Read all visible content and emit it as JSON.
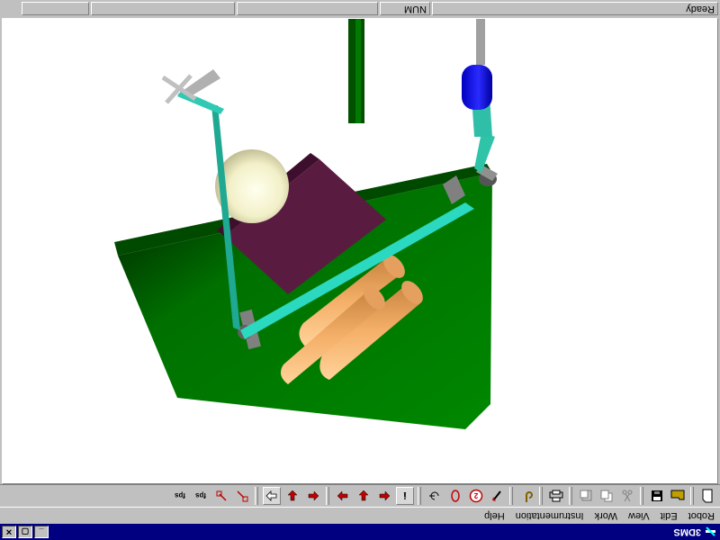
{
  "window": {
    "title": "3DMS"
  },
  "menu": [
    "Robot",
    "Edit",
    "View",
    "Work",
    "Instrumentation",
    "Help"
  ],
  "toolbar": {
    "buttons": [
      {
        "icon": "new-document-icon"
      },
      {
        "icon": "open-folder-icon"
      },
      {
        "icon": "save-disk-icon"
      },
      {
        "icon": "cut-icon"
      },
      {
        "icon": "copy-icon"
      },
      {
        "icon": "paste-icon"
      },
      {
        "icon": "print-icon"
      },
      {
        "icon": "hook-icon"
      },
      {
        "icon": "robot-arrow-icon"
      },
      {
        "icon": "step-icon",
        "label": "2"
      },
      {
        "icon": "circle-icon"
      },
      {
        "icon": "target-icon"
      },
      {
        "icon": "info-icon",
        "label": "i"
      },
      {
        "icon": "move-left-icon"
      },
      {
        "icon": "move-down-icon"
      },
      {
        "icon": "move-right-icon"
      },
      {
        "icon": "arrow-left-icon"
      },
      {
        "icon": "arrow-down-icon"
      },
      {
        "icon": "arrow-right-icon"
      },
      {
        "icon": "red-arrow-1-icon"
      },
      {
        "icon": "red-arrow-2-icon"
      },
      {
        "icon": "fps-icon",
        "label": "fps"
      },
      {
        "icon": "fps-icon",
        "label": "fps"
      }
    ]
  },
  "status": {
    "text": "Ready",
    "num": "NUM"
  }
}
